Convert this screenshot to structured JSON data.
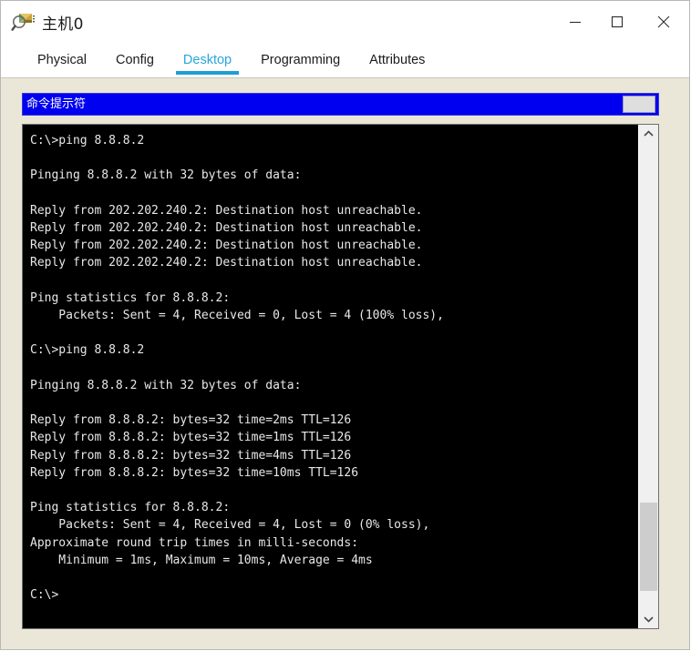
{
  "window": {
    "title": "主机0",
    "icon": "device-inspect-icon",
    "controls": [
      {
        "name": "minimize-button",
        "glyph": "—"
      },
      {
        "name": "maximize-button",
        "glyph": "□"
      },
      {
        "name": "close-button",
        "glyph": "✕"
      }
    ]
  },
  "tabs": [
    {
      "label": "Physical",
      "active": false
    },
    {
      "label": "Config",
      "active": false
    },
    {
      "label": "Desktop",
      "active": true
    },
    {
      "label": "Programming",
      "active": false
    },
    {
      "label": "Attributes",
      "active": false
    }
  ],
  "colors": {
    "accent": "#1e9ed6",
    "panel_bg": "#eae7d8",
    "cmd_titlebar": "#0000f0",
    "terminal_bg": "#000000",
    "terminal_fg": "#e8e8e8"
  },
  "cmd_window": {
    "title": "命令提示符",
    "title_button_label": ""
  },
  "terminal": {
    "prompt": "C:\\>",
    "lines": [
      "C:\\>ping 8.8.8.2",
      "",
      "Pinging 8.8.8.2 with 32 bytes of data:",
      "",
      "Reply from 202.202.240.2: Destination host unreachable.",
      "Reply from 202.202.240.2: Destination host unreachable.",
      "Reply from 202.202.240.2: Destination host unreachable.",
      "Reply from 202.202.240.2: Destination host unreachable.",
      "",
      "Ping statistics for 8.8.8.2:",
      "    Packets: Sent = 4, Received = 0, Lost = 4 (100% loss),",
      "",
      "C:\\>ping 8.8.8.2",
      "",
      "Pinging 8.8.8.2 with 32 bytes of data:",
      "",
      "Reply from 8.8.8.2: bytes=32 time=2ms TTL=126",
      "Reply from 8.8.8.2: bytes=32 time=1ms TTL=126",
      "Reply from 8.8.8.2: bytes=32 time=4ms TTL=126",
      "Reply from 8.8.8.2: bytes=32 time=10ms TTL=126",
      "",
      "Ping statistics for 8.8.8.2:",
      "    Packets: Sent = 4, Received = 4, Lost = 0 (0% loss),",
      "Approximate round trip times in milli-seconds:",
      "    Minimum = 1ms, Maximum = 10ms, Average = 4ms",
      "",
      "C:\\>"
    ]
  },
  "scrollbar": {
    "up_arrow": "⌃",
    "down_arrow": "⌄",
    "thumb_top_percent": 77,
    "thumb_height_percent": 19
  }
}
